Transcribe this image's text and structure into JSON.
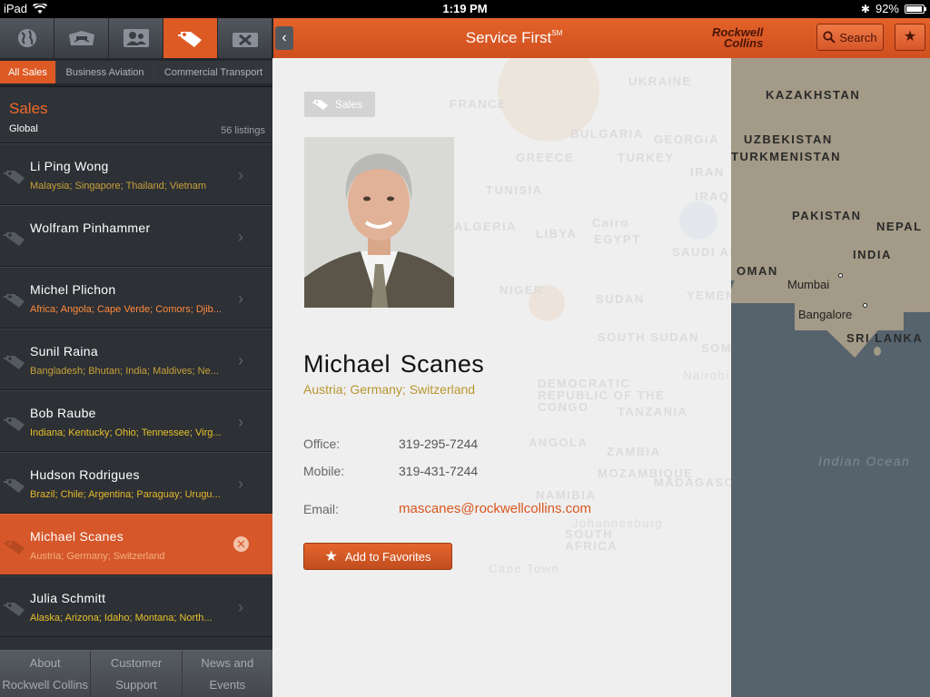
{
  "status_bar": {
    "carrier": "iPad",
    "time": "1:19 PM",
    "battery": "92%",
    "battery_level": 0.92
  },
  "nav_icons": [
    {
      "name": "globe-icon",
      "active": false
    },
    {
      "name": "aircraft-icon",
      "active": false
    },
    {
      "name": "contacts-icon",
      "active": false
    },
    {
      "name": "tags-icon",
      "active": true
    },
    {
      "name": "tools-icon",
      "active": false
    }
  ],
  "segments": [
    {
      "label": "All Sales",
      "active": true
    },
    {
      "label": "Business Aviation",
      "active": false
    },
    {
      "label": "Commercial Transport",
      "active": false
    }
  ],
  "sales_header": {
    "title": "Sales",
    "scope": "Global",
    "count": "56 listings"
  },
  "contacts": [
    {
      "name": "Li Ping Wong",
      "regions": "Malaysia; Singapore; Thailand; Vietnam",
      "color": "#c7a13a",
      "selected": false
    },
    {
      "name": "Wolfram Pinhammer",
      "regions": "",
      "color": "#c7a13a",
      "selected": false
    },
    {
      "name": "Michel Plichon",
      "regions": "Africa; Angola; Cape Verde; Comors; Djib...",
      "color": "#ff8a3c",
      "selected": false
    },
    {
      "name": "Sunil Raina",
      "regions": "Bangladesh; Bhutan; India; Maldives; Ne...",
      "color": "#c7a13a",
      "selected": false
    },
    {
      "name": "Bob Raube",
      "regions": "Indiana; Kentucky; Ohio; Tennessee; Virg...",
      "color": "#e6c12a",
      "selected": false
    },
    {
      "name": "Hudson Rodrigues",
      "regions": "Brazil; Chile; Argentina; Paraguay; Urugu...",
      "color": "#e6b82a",
      "selected": false
    },
    {
      "name": "Michael Scanes",
      "regions": "Austria; Germany; Switzerland",
      "color": "#f1b07d",
      "selected": true
    },
    {
      "name": "Julia Schmitt",
      "regions": "Alaska; Arizona; Idaho; Montana; North...",
      "color": "#e6c12a",
      "selected": false
    }
  ],
  "bottom_tabs": [
    {
      "line1": "About",
      "line2": "Rockwell Collins"
    },
    {
      "line1": "Customer",
      "line2": "Support"
    },
    {
      "line1": "News and",
      "line2": "Events"
    }
  ],
  "header": {
    "title": "Service First",
    "title_mark": "SM",
    "brand_line1": "Rockwell",
    "brand_line2": "Collins",
    "search_label": "Search"
  },
  "detail": {
    "badge": "Sales",
    "name": "Michael Scanes",
    "regions": "Austria; Germany; Switzerland",
    "office_label": "Office:",
    "office_value": "319-295-7244",
    "mobile_label": "Mobile:",
    "mobile_value": "319-431-7244",
    "email_label": "Email:",
    "email_value": "mascanes@rockwellcollins.com",
    "favorites_label": "Add to Favorites"
  },
  "map": {
    "countries": [
      "KAZAKHSTAN",
      "UZBEKISTAN",
      "TURKMENISTAN",
      "PAKISTAN",
      "NEPAL",
      "INDIA",
      "OMAN",
      "SRI LANKA"
    ],
    "cities": [
      "Mumbai",
      "Bangalore"
    ],
    "ocean": "Indian Ocean",
    "ghost_labels": [
      "UKRAINE",
      "FRANCE",
      "BULGARIA",
      "GEORGIA",
      "GREECE",
      "TURKEY",
      "TUNISIA",
      "IRAQ",
      "IRAN",
      "LIBYA",
      "EGYPT",
      "Cairo",
      "SAUDI ARABIA",
      "ALGERIA",
      "NIGER",
      "SUDAN",
      "YEMEN",
      "SOUTH SUDAN",
      "SOMALIA",
      "DEMOCRATIC REPUBLIC OF THE CONGO",
      "TANZANIA",
      "ANGOLA",
      "ZAMBIA",
      "MOZAMBIQUE",
      "NAMIBIA",
      "MADAGASCAR",
      "SOUTH AFRICA",
      "Nairobi",
      "Johannesburg",
      "Cape Town"
    ]
  }
}
